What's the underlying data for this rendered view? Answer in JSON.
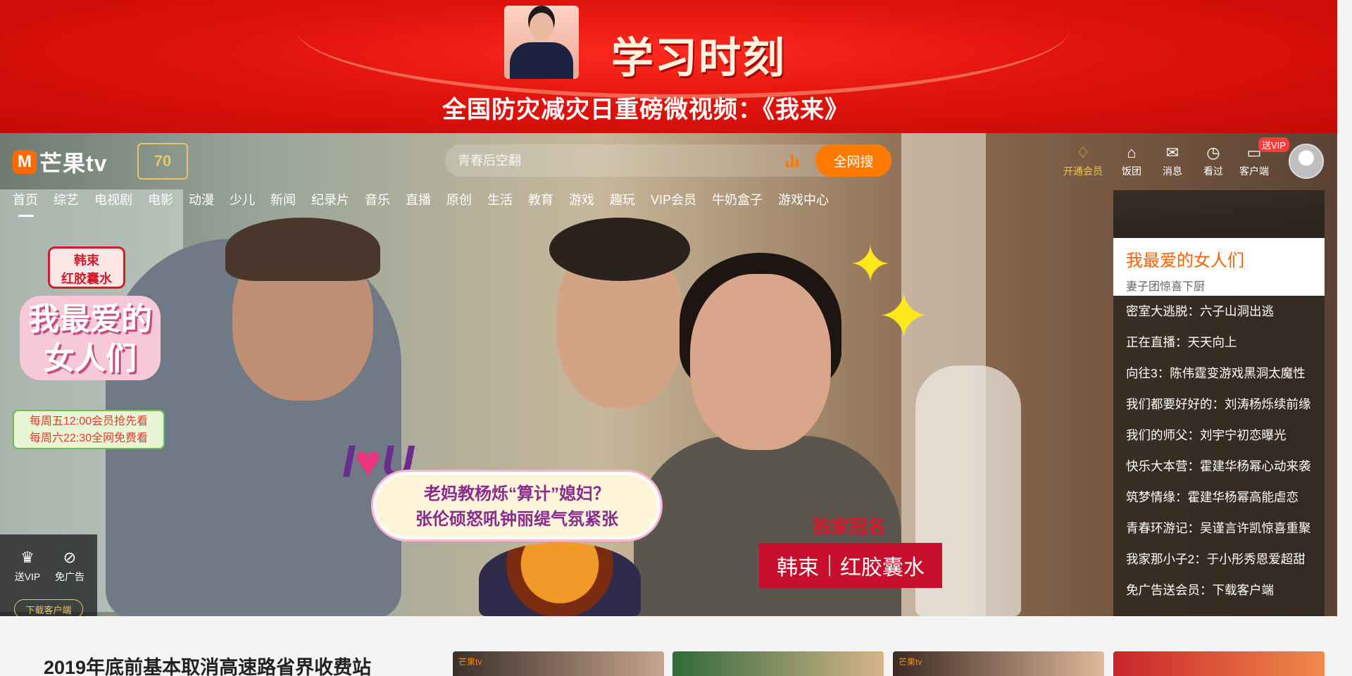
{
  "banner": {
    "title": "学习时刻",
    "subtitle": "全国防灾减灾日重磅微视频：《我来》"
  },
  "header": {
    "logo_text": "芒果tv",
    "logo_mark": "M",
    "anniversary_badge": "70"
  },
  "search": {
    "placeholder": "青春后空翻",
    "button_label": "全网搜"
  },
  "toolbar": {
    "items": [
      {
        "label": "开通会员",
        "icon": "diamond-icon"
      },
      {
        "label": "饭团",
        "icon": "home-icon"
      },
      {
        "label": "消息",
        "icon": "mail-icon"
      },
      {
        "label": "看过",
        "icon": "clock-icon"
      },
      {
        "label": "客户端",
        "icon": "device-icon"
      }
    ],
    "gift_badge": "送VIP"
  },
  "nav": {
    "items": [
      "首页",
      "综艺",
      "电视剧",
      "电影",
      "动漫",
      "少儿",
      "新闻",
      "纪录片",
      "音乐",
      "直播",
      "原创",
      "生活",
      "教育",
      "游戏",
      "趣玩",
      "VIP会员",
      "牛奶盒子",
      "游戏中心"
    ],
    "active_index": 0
  },
  "hero": {
    "promo_brand": "韩束\n红胶囊水",
    "promo_title": "我最爱的女人们",
    "promo_schedule_1": "每周五12:00会员抢先看",
    "promo_schedule_2": "每周六22:30全网免费看",
    "love_tag_i": "I",
    "love_tag_u": "U",
    "caption_line1": "老妈教杨烁“算计”媳妇？",
    "caption_line2": "张伦硕怒吼钟丽缇气氛紧张",
    "sponsor_label": "独家冠名",
    "sponsor_brand_1": "韩束",
    "sponsor_brand_2": "红胶囊水"
  },
  "mini_panel": {
    "vip_label": "送VIP",
    "noad_label": "免广告",
    "download_label": "下载客户端"
  },
  "recommend": {
    "featured_title": "我最爱的女人们",
    "featured_subtitle": "妻子团惊喜下厨",
    "items": [
      "密室大逃脱：六子山洞出逃",
      "正在直播：天天向上",
      "向往3：陈伟霆变游戏黑洞太魔性",
      "我们都要好好的：刘涛杨烁续前缘",
      "我们的师父：刘宇宁初恋曝光",
      "快乐大本营：霍建华杨幂心动来袭",
      "筑梦情缘：霍建华杨幂高能虐恋",
      "青春环游记：吴谨言许凯惊喜重聚",
      "我家那小子2：于小彤秀恩爱超甜",
      "免广告送会员：下载客户端"
    ]
  },
  "bottom": {
    "headline": "2019年底前基本取消高速路省界收费站",
    "thumb_tag": "芒果tv"
  },
  "colors": {
    "accent": "#ff7a00",
    "banner_red": "#e0130d",
    "featured_title": "#ff5f00",
    "vip_gold": "#f0c24a"
  }
}
